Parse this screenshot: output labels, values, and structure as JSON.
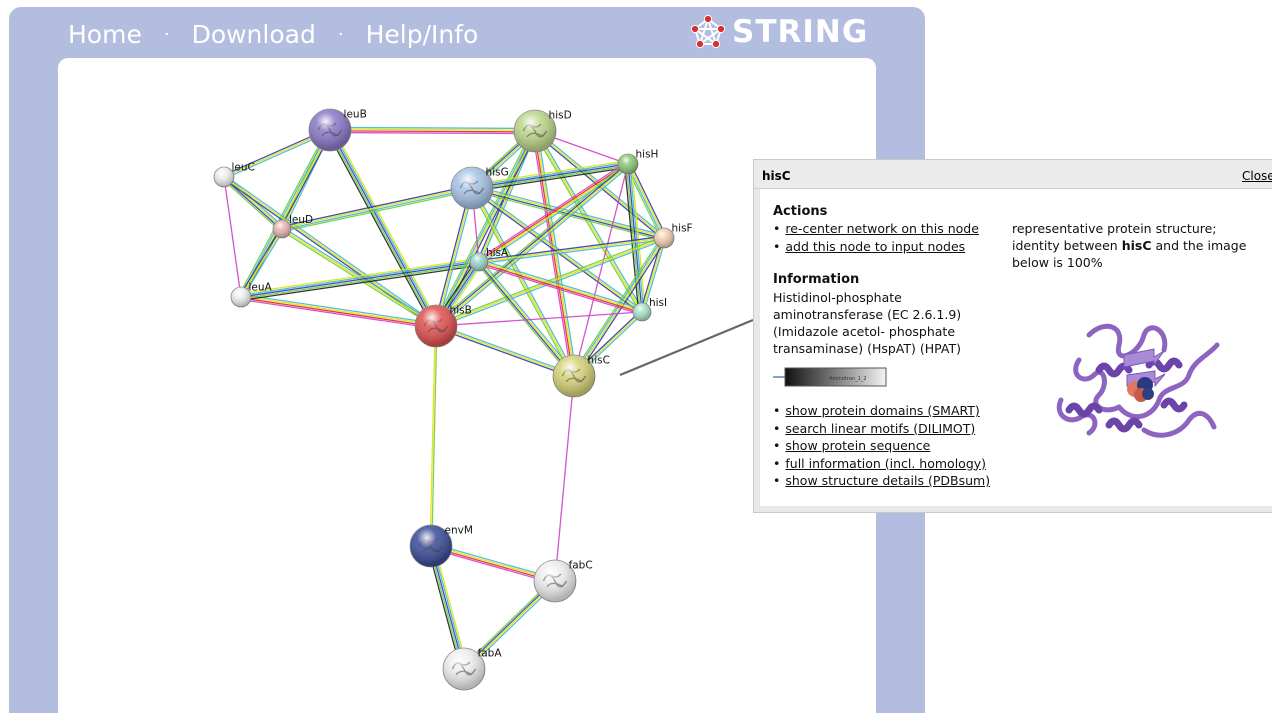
{
  "nav": {
    "home": "Home",
    "download": "Download",
    "help": "Help/Info",
    "separator": "·",
    "logo_text": "STRING"
  },
  "network": {
    "nodes": [
      {
        "id": "leuB",
        "label": "leuB",
        "color": "#8a78c8",
        "kind": "structure"
      },
      {
        "id": "leuC",
        "label": "leuC",
        "color": "#eeeeee",
        "kind": "plain"
      },
      {
        "id": "leuD",
        "label": "leuD",
        "color": "#e8b6b2",
        "kind": "plain"
      },
      {
        "id": "leuA",
        "label": "leuA",
        "color": "#eeeeee",
        "kind": "plain"
      },
      {
        "id": "hisD",
        "label": "hisD",
        "color": "#bcd68a",
        "kind": "structure"
      },
      {
        "id": "hisG",
        "label": "hisG",
        "color": "#a6c4e6",
        "kind": "structure"
      },
      {
        "id": "hisH",
        "label": "hisH",
        "color": "#8cc878",
        "kind": "plain"
      },
      {
        "id": "hisF",
        "label": "hisF",
        "color": "#f2cfb0",
        "kind": "plain"
      },
      {
        "id": "hisA",
        "label": "hisA",
        "color": "#9ad6c8",
        "kind": "plain"
      },
      {
        "id": "hisI",
        "label": "hisI",
        "color": "#a8e2c8",
        "kind": "plain"
      },
      {
        "id": "hisB",
        "label": "hisB",
        "color": "#e05050",
        "kind": "structure"
      },
      {
        "id": "hisC",
        "label": "hisC",
        "color": "#d6d27a",
        "kind": "structure"
      },
      {
        "id": "envM",
        "label": "envM",
        "color": "#3a4c98",
        "kind": "structure"
      },
      {
        "id": "fabC",
        "label": "fabC",
        "color": "#eeeeee",
        "kind": "structure"
      },
      {
        "id": "fabA",
        "label": "fabA",
        "color": "#eeeeee",
        "kind": "structure"
      }
    ],
    "edges": [
      [
        "leuB",
        "leuC"
      ],
      [
        "leuB",
        "leuD"
      ],
      [
        "leuB",
        "leuA"
      ],
      [
        "leuB",
        "hisD"
      ],
      [
        "leuB",
        "hisB"
      ],
      [
        "leuC",
        "leuD"
      ],
      [
        "leuC",
        "leuA"
      ],
      [
        "leuC",
        "hisB"
      ],
      [
        "leuD",
        "leuA"
      ],
      [
        "leuD",
        "hisB"
      ],
      [
        "leuD",
        "hisG"
      ],
      [
        "leuA",
        "hisB"
      ],
      [
        "leuA",
        "hisA"
      ],
      [
        "hisD",
        "hisG"
      ],
      [
        "hisD",
        "hisH"
      ],
      [
        "hisD",
        "hisF"
      ],
      [
        "hisD",
        "hisA"
      ],
      [
        "hisD",
        "hisI"
      ],
      [
        "hisD",
        "hisB"
      ],
      [
        "hisD",
        "hisC"
      ],
      [
        "hisG",
        "hisH"
      ],
      [
        "hisG",
        "hisF"
      ],
      [
        "hisG",
        "hisA"
      ],
      [
        "hisG",
        "hisI"
      ],
      [
        "hisG",
        "hisB"
      ],
      [
        "hisG",
        "hisC"
      ],
      [
        "hisH",
        "hisF"
      ],
      [
        "hisH",
        "hisA"
      ],
      [
        "hisH",
        "hisI"
      ],
      [
        "hisH",
        "hisB"
      ],
      [
        "hisH",
        "hisC"
      ],
      [
        "hisF",
        "hisA"
      ],
      [
        "hisF",
        "hisI"
      ],
      [
        "hisF",
        "hisB"
      ],
      [
        "hisF",
        "hisC"
      ],
      [
        "hisA",
        "hisI"
      ],
      [
        "hisA",
        "hisB"
      ],
      [
        "hisA",
        "hisC"
      ],
      [
        "hisI",
        "hisB"
      ],
      [
        "hisI",
        "hisC"
      ],
      [
        "hisB",
        "hisC"
      ],
      [
        "hisB",
        "envM"
      ],
      [
        "hisC",
        "fabC"
      ],
      [
        "envM",
        "fabC"
      ],
      [
        "envM",
        "fabA"
      ],
      [
        "fabC",
        "fabA"
      ]
    ],
    "edge_colors": [
      "#3cb8d8",
      "#e8e000",
      "#2c3cb0",
      "#70cc40",
      "#e02828",
      "#d040c8",
      "#202020"
    ]
  },
  "popup": {
    "title": "hisC",
    "close": "Close",
    "actions_heading": "Actions",
    "actions": [
      "re-center network on this node",
      "add this node to input nodes"
    ],
    "information_heading": "Information",
    "information_lines": [
      "Histidinol-phosphate",
      "aminotransferase (EC 2.6.1.9)",
      "(Imidazole acetol- phosphate",
      "transaminase) (HspAT) (HPAT)"
    ],
    "domain_bar_label": "Aminotran_1_2",
    "links": [
      "show protein domains (SMART)",
      "search linear motifs (DILIMOT)",
      "show protein sequence",
      "full information (incl. homology)",
      "show structure details (PDBsum)"
    ],
    "structure_text_1": "representative protein structure;",
    "structure_text_2": "identity between ",
    "structure_bold": "hisC",
    "structure_text_3": " and the image",
    "structure_text_4": "below is 100%",
    "structure_image": "protein-structure-ribbon-icon",
    "structure_color": "#8d64c0"
  }
}
